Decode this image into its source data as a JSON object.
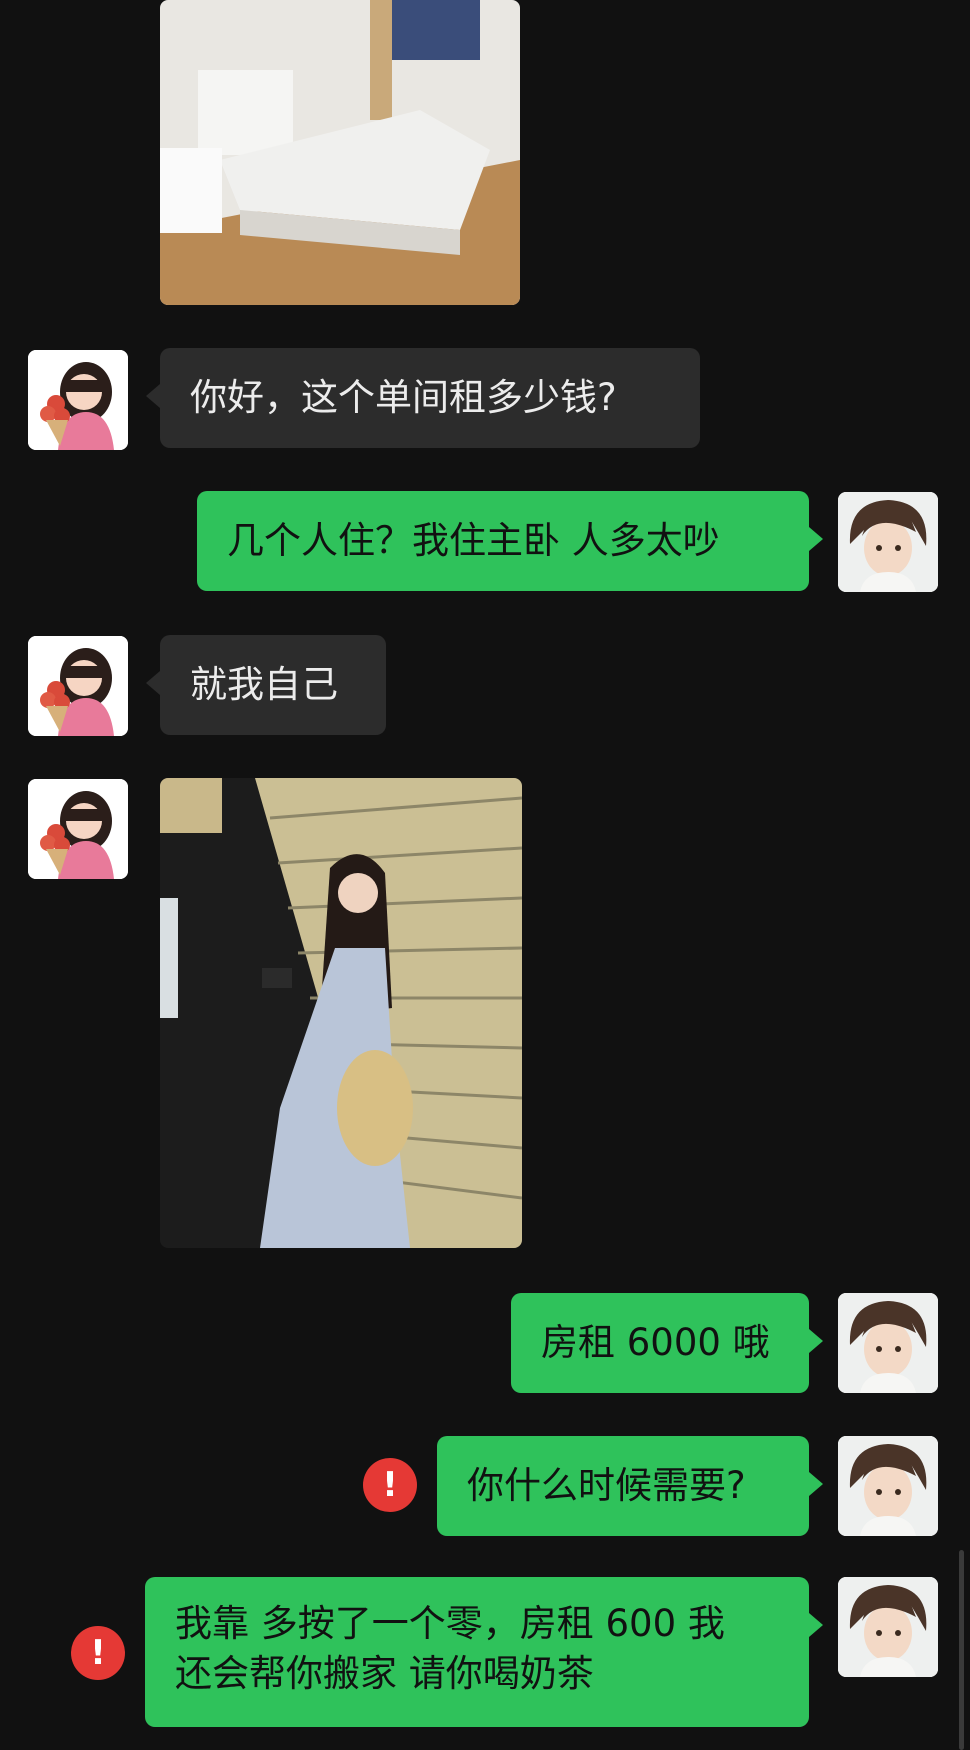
{
  "messages": {
    "m1": "你好，这个单间租多少钱?",
    "m2": "几个人住？我住主卧 人多太吵",
    "m3": "就我自己",
    "m4": "房租 6000 哦",
    "m5": "你什么时候需要?",
    "m6_line1": "我靠 多按了一个零，房租 600 我",
    "m6_line2": "还会帮你搬家 请你喝奶茶"
  },
  "icons": {
    "error": "!"
  },
  "colors": {
    "background": "#111111",
    "incoming_bubble": "#2c2c2c",
    "outgoing_bubble": "#2fc25b",
    "error": "#e53935"
  }
}
